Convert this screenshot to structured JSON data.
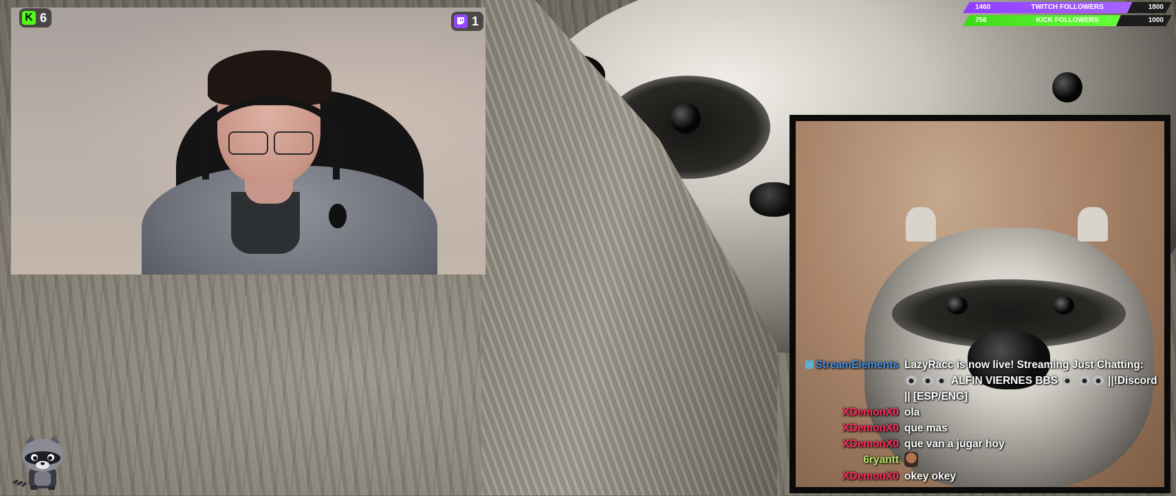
{
  "overlay": {
    "kick_badge": {
      "icon": "kick-icon",
      "count": "6"
    },
    "twitch_badge": {
      "icon": "twitch-icon",
      "count": "1"
    }
  },
  "goals": {
    "twitch": {
      "current": "1460",
      "label": "TWITCH FOLLOWERS",
      "target": "1800",
      "progress": 0.811,
      "color": "#9146ff"
    },
    "kick": {
      "current": "756",
      "label": "KICK FOLLOWERS",
      "target": "1000",
      "progress": 0.756,
      "color": "#53fc18"
    }
  },
  "chat": {
    "messages": [
      {
        "name": "StreamElements",
        "color": "#4a90e2",
        "has_icon": true,
        "text_parts": [
          "LazyRacc is now live! Streaming Just Chatting: ",
          " ",
          " ALFIN VIERNES BBS ",
          " ",
          " ||!Discord || [ESP/ENG]"
        ]
      },
      {
        "name": "XDemonX0",
        "color": "#ff2a5a",
        "text": "ola"
      },
      {
        "name": "XDemonX0",
        "color": "#ff2a5a",
        "text": "que mas"
      },
      {
        "name": "XDemonX0",
        "color": "#ff2a5a",
        "text": "que van a jugar hoy"
      },
      {
        "name": "6ryantt",
        "color": "#b7e86b",
        "text": ""
      },
      {
        "name": "XDemonX0",
        "color": "#ff2a5a",
        "text": "okey okey"
      }
    ]
  },
  "colors": {
    "kick_green": "#53fc18",
    "twitch_purple": "#9146ff"
  }
}
